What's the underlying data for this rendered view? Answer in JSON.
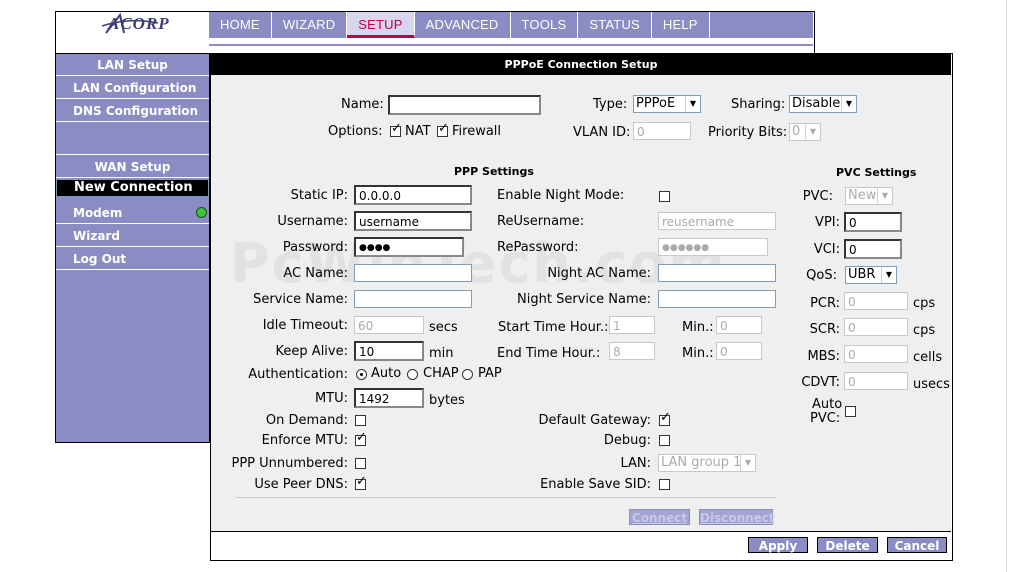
{
  "header": {
    "logo_text": "ACORP",
    "nav": [
      "HOME",
      "WIZARD",
      "SETUP",
      "ADVANCED",
      "TOOLS",
      "STATUS",
      "HELP"
    ],
    "active_nav": "SETUP"
  },
  "sidebar": {
    "lan_header": "LAN Setup",
    "lan_items": [
      "LAN Configuration",
      "DNS Configuration"
    ],
    "wan_header": "WAN Setup",
    "wan_items": [
      "New Connection",
      "Modem",
      "Wizard",
      "Log Out"
    ],
    "selected": "New Connection"
  },
  "panel": {
    "title": "PPPoE Connection Setup",
    "name_label": "Name:",
    "name_value": "",
    "type_label": "Type:",
    "type_value": "PPPoE",
    "sharing_label": "Sharing:",
    "sharing_value": "Disable",
    "options_label": "Options:",
    "nat_label": "NAT",
    "firewall_label": "Firewall",
    "vlan_label": "VLAN ID:",
    "vlan_value": "0",
    "priority_label": "Priority Bits:",
    "priority_value": "0"
  },
  "ppp": {
    "title": "PPP Settings",
    "static_ip_label": "Static IP:",
    "static_ip_value": "0.0.0.0",
    "username_label": "Username:",
    "username_value": "username",
    "password_label": "Password:",
    "password_value": "●●●●",
    "ac_name_label": "AC Name:",
    "service_name_label": "Service Name:",
    "idle_timeout_label": "Idle Timeout:",
    "idle_timeout_value": "60",
    "idle_timeout_unit": "secs",
    "keep_alive_label": "Keep Alive:",
    "keep_alive_value": "10",
    "keep_alive_unit": "min",
    "auth_label": "Authentication:",
    "auth_options": [
      "Auto",
      "CHAP",
      "PAP"
    ],
    "mtu_label": "MTU:",
    "mtu_value": "1492",
    "mtu_unit": "bytes",
    "on_demand_label": "On Demand:",
    "enforce_mtu_label": "Enforce MTU:",
    "ppp_unnumbered_label": "PPP Unnumbered:",
    "use_peer_dns_label": "Use Peer DNS:",
    "night_mode_label": "Enable Night Mode:",
    "reusername_label": "ReUsername:",
    "reusername_value": "reusername",
    "repassword_label": "RePassword:",
    "repassword_value": "●●●●●●",
    "night_ac_label": "Night AC Name:",
    "night_service_label": "Night Service Name:",
    "start_hour_label": "Start Time Hour.:",
    "start_hour_value": "1",
    "start_min_label": "Min.:",
    "start_min_value": "0",
    "end_hour_label": "End Time Hour.:",
    "end_hour_value": "8",
    "end_min_label": "Min.:",
    "end_min_value": "0",
    "default_gw_label": "Default Gateway:",
    "debug_label": "Debug:",
    "lan_label": "LAN:",
    "lan_value": "LAN group 1",
    "save_sid_label": "Enable Save SID:"
  },
  "pvc": {
    "title": "PVC Settings",
    "pvc_label": "PVC:",
    "pvc_value": "New",
    "vpi_label": "VPI:",
    "vpi_value": "0",
    "vci_label": "VCI:",
    "vci_value": "0",
    "qos_label": "QoS:",
    "qos_value": "UBR",
    "pcr_label": "PCR:",
    "pcr_value": "0",
    "pcr_unit": "cps",
    "scr_label": "SCR:",
    "scr_value": "0",
    "scr_unit": "cps",
    "mbs_label": "MBS:",
    "mbs_value": "0",
    "mbs_unit": "cells",
    "cdvt_label": "CDVT:",
    "cdvt_value": "0",
    "cdvt_unit": "usecs",
    "auto_pvc_label_1": "Auto",
    "auto_pvc_label_2": "PVC:"
  },
  "buttons": {
    "connect": "Connect",
    "disconnect": "Disconnect",
    "apply": "Apply",
    "delete": "Delete",
    "cancel": "Cancel"
  },
  "watermark": "PcWinTech.com"
}
